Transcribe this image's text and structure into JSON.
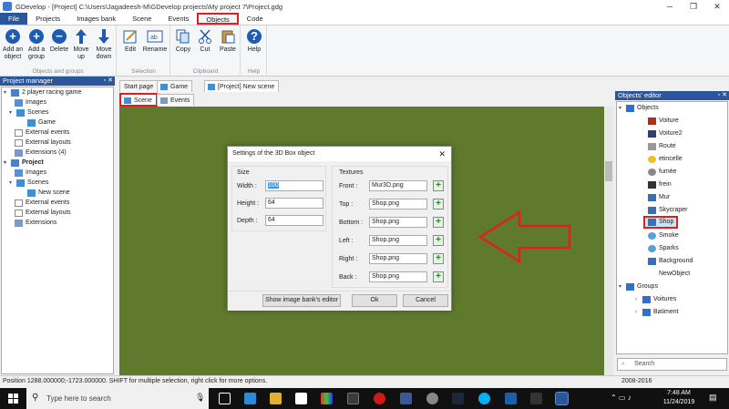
{
  "window": {
    "title": "GDevelop - [Project] C:\\Users\\Jagadeesh-M\\GDevelop projects\\My project 7\\Project.gdg"
  },
  "menu": {
    "tabs": [
      "File",
      "Projects",
      "Images bank",
      "Scene",
      "Events",
      "Objects",
      "Code"
    ],
    "active": "Objects"
  },
  "ribbon": {
    "groups": [
      {
        "label": "Objects and groups",
        "buttons": [
          "Add an object",
          "Add a group",
          "Delete",
          "Move up",
          "Move down"
        ]
      },
      {
        "label": "Selection",
        "buttons": [
          "Edit",
          "Rename"
        ]
      },
      {
        "label": "Clipboard",
        "buttons": [
          "Copy",
          "Cut",
          "Paste"
        ]
      },
      {
        "label": "Help",
        "buttons": [
          "Help"
        ]
      }
    ]
  },
  "project_manager": {
    "title": "Project manager",
    "items": [
      "2 player racing game",
      "Images",
      "Scenes",
      "Game",
      "External events",
      "External layouts",
      "Extensions (4)",
      "Project",
      "Images",
      "Scenes",
      "New scene",
      "External events",
      "External layouts",
      "Extensions"
    ]
  },
  "editor_tabs": [
    "Start page",
    "Game",
    "[Project] New scene"
  ],
  "sub_tabs": [
    "Scene",
    "Events"
  ],
  "objects_editor": {
    "title": "Objects' editor",
    "root": "Objects",
    "objects": [
      "Voiture",
      "Voiture2",
      "Route",
      "etincelle",
      "fumée",
      "frein",
      "Mur",
      "Skycraper",
      "Shop",
      "Smoke",
      "Sparks",
      "Background",
      "NewObject"
    ],
    "selected": "Shop",
    "groups_label": "Groups",
    "groups": [
      "Voitures",
      "Batiment"
    ],
    "search_placeholder": "Search"
  },
  "dialog": {
    "title": "Settings of the 3D Box object",
    "size_label": "Size",
    "width_label": "Width :",
    "width": "100",
    "height_label": "Height :",
    "height": "64",
    "depth_label": "Depth :",
    "depth": "64",
    "textures_label": "Textures",
    "textures": [
      {
        "label": "Front :",
        "value": "Mur3D.png"
      },
      {
        "label": "Top :",
        "value": "Shop.png"
      },
      {
        "label": "Bottom :",
        "value": "Shop.png"
      },
      {
        "label": "Left :",
        "value": "Shop.png"
      },
      {
        "label": "Right :",
        "value": "Shop.png"
      },
      {
        "label": "Back :",
        "value": "Shop.png"
      }
    ],
    "image_bank_button": "Show image bank's editor",
    "ok_button": "Ok",
    "cancel_button": "Cancel"
  },
  "status": {
    "text": "Position 1288.000000;-1723.000000. SHIFT for multiple selection, right click for more options.",
    "years": "2008-2016"
  },
  "taskbar": {
    "search_placeholder": "Type here to search",
    "time": "7:48 AM",
    "date": "11/24/2019"
  },
  "colors": {
    "scene_bg": "#5f7a2d",
    "accent": "#2b579a",
    "highlight": "#e02020"
  }
}
